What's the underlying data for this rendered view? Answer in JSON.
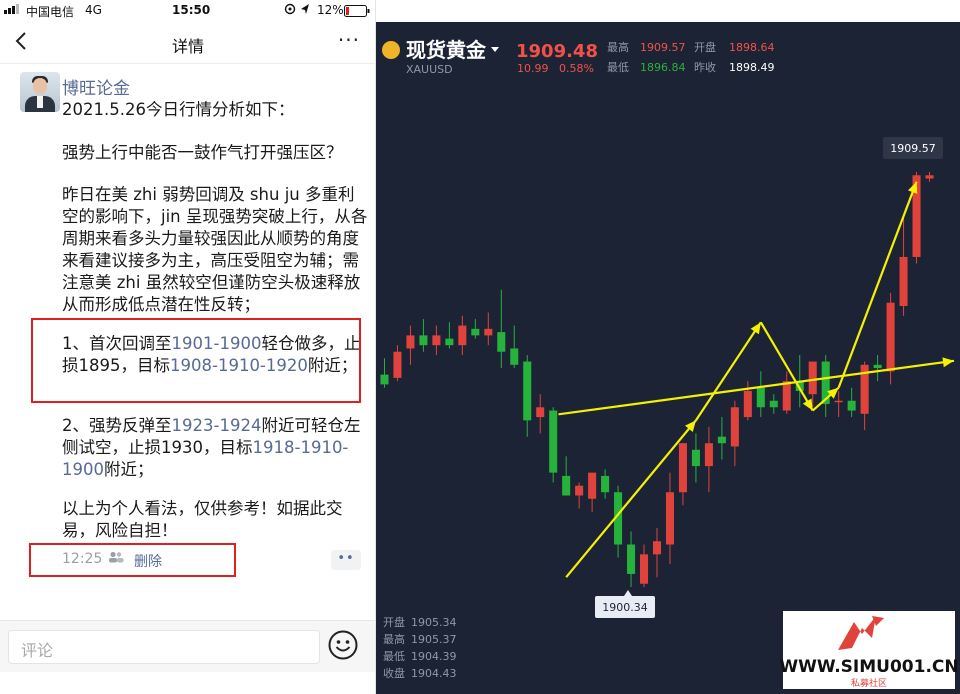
{
  "status_bar": {
    "carrier": "中国电信",
    "network": "4G",
    "time": "15:50",
    "battery_percent": "12%"
  },
  "nav": {
    "back_icon": "chevron-left-icon",
    "title": "详情",
    "more_icon": "more-dots-icon",
    "more_text": "···"
  },
  "post": {
    "author": "博旺论金",
    "date_line": "2021.5.26今日行情分析如下：",
    "question": "强势上行中能否一鼓作气打开强压区？",
    "body": "昨日在美  zhi  弱势回调及  shu  ju  多重利空的影响下，jin  呈现强势突破上行，从各周期来看多头力量较强因此从顺势的角度来看建议接多为主，高压受阻空为辅；需注意美  zhi  虽然较空但谨防空头极速释放从而形成低点潜在性反转；",
    "plan1": {
      "prefix": "1、首次回调至",
      "zone": "1901-1900",
      "mid": "轻仓做多，止损1895，目标",
      "targets": "1908-1910-1920",
      "suffix": "附近；"
    },
    "plan2": {
      "prefix": "2、强势反弹至",
      "zone": "1923-1924",
      "mid": "附近可轻仓左侧试空，止损1930，目标",
      "targets": "1918-1910-1900",
      "suffix": "附近；"
    },
    "disclaimer": "以上为个人看法，仅供参考！如据此交易，风险自担！",
    "time": "12:25",
    "delete_label": "删除",
    "more_label": "••"
  },
  "comment": {
    "placeholder": "评论",
    "emoji_icon": "smiley-icon"
  },
  "chart": {
    "name": "现货黄金",
    "symbol": "XAUUSD",
    "price": "1909.48",
    "change": "10.99",
    "change_pct": "0.58%",
    "stats": {
      "high_label": "最高",
      "high": "1909.57",
      "open_label": "开盘",
      "open": "1898.64",
      "low_label": "最低",
      "low": "1896.84",
      "prev_label": "昨收",
      "prev": "1898.49"
    },
    "bottom_info": [
      {
        "label": "开盘",
        "value": "1905.34"
      },
      {
        "label": "最高",
        "value": "1905.37"
      },
      {
        "label": "最低",
        "value": "1904.39"
      },
      {
        "label": "收盘",
        "value": "1904.43"
      }
    ],
    "tag_high": "1909.57",
    "tag_low": "1900.34",
    "colors": {
      "background": "#1c2334",
      "up": "#e0433b",
      "down": "#27b23c",
      "annotation": "#f5f200",
      "text_muted": "#8f97a8",
      "price_red": "#f0524a"
    }
  },
  "watermark": {
    "text": "WWW.SIMU001.CN",
    "subtext": "私募社区"
  },
  "chart_data": {
    "type": "candlestick",
    "title": "现货黄金",
    "candles": [
      {
        "o": 1903.4,
        "h": 1903.9,
        "l": 1903.0,
        "c": 1903.1
      },
      {
        "o": 1903.3,
        "h": 1904.3,
        "l": 1903.2,
        "c": 1904.1
      },
      {
        "o": 1904.2,
        "h": 1904.9,
        "l": 1903.7,
        "c": 1904.6
      },
      {
        "o": 1904.6,
        "h": 1905.1,
        "l": 1904.1,
        "c": 1904.3
      },
      {
        "o": 1904.3,
        "h": 1904.9,
        "l": 1904.0,
        "c": 1904.6
      },
      {
        "o": 1904.5,
        "h": 1905.0,
        "l": 1904.2,
        "c": 1904.3
      },
      {
        "o": 1904.3,
        "h": 1905.2,
        "l": 1904.0,
        "c": 1904.9
      },
      {
        "o": 1904.8,
        "h": 1905.1,
        "l": 1904.5,
        "c": 1904.6
      },
      {
        "o": 1904.6,
        "h": 1905.3,
        "l": 1904.3,
        "c": 1904.8
      },
      {
        "o": 1904.7,
        "h": 1906.0,
        "l": 1903.6,
        "c": 1904.1
      },
      {
        "o": 1904.2,
        "h": 1904.9,
        "l": 1903.6,
        "c": 1903.7
      },
      {
        "o": 1903.8,
        "h": 1904.0,
        "l": 1901.5,
        "c": 1902.0
      },
      {
        "o": 1902.1,
        "h": 1902.8,
        "l": 1901.6,
        "c": 1902.4
      },
      {
        "o": 1902.3,
        "h": 1902.4,
        "l": 1900.1,
        "c": 1900.4
      },
      {
        "o": 1900.3,
        "h": 1900.9,
        "l": 1899.9,
        "c": 1899.7
      },
      {
        "o": 1899.7,
        "h": 1900.1,
        "l": 1899.3,
        "c": 1900.0
      },
      {
        "o": 1899.6,
        "h": 1900.4,
        "l": 1899.2,
        "c": 1900.4
      },
      {
        "o": 1900.3,
        "h": 1900.5,
        "l": 1899.6,
        "c": 1899.8
      },
      {
        "o": 1899.8,
        "h": 1900.0,
        "l": 1897.8,
        "c": 1898.2
      },
      {
        "o": 1898.2,
        "h": 1898.6,
        "l": 1896.9,
        "c": 1897.3
      },
      {
        "o": 1897.0,
        "h": 1898.2,
        "l": 1896.9,
        "c": 1897.9
      },
      {
        "o": 1897.9,
        "h": 1898.7,
        "l": 1897.2,
        "c": 1898.3
      },
      {
        "o": 1898.2,
        "h": 1900.4,
        "l": 1897.6,
        "c": 1899.8
      },
      {
        "o": 1899.8,
        "h": 1901.3,
        "l": 1899.4,
        "c": 1901.3
      },
      {
        "o": 1901.1,
        "h": 1901.6,
        "l": 1900.1,
        "c": 1900.6
      },
      {
        "o": 1900.6,
        "h": 1901.8,
        "l": 1899.8,
        "c": 1901.3
      },
      {
        "o": 1901.5,
        "h": 1902.1,
        "l": 1900.8,
        "c": 1901.3
      },
      {
        "o": 1901.2,
        "h": 1902.6,
        "l": 1900.6,
        "c": 1902.4
      },
      {
        "o": 1902.1,
        "h": 1903.2,
        "l": 1902.0,
        "c": 1902.9
      },
      {
        "o": 1903.0,
        "h": 1903.5,
        "l": 1902.1,
        "c": 1902.4
      },
      {
        "o": 1902.6,
        "h": 1902.8,
        "l": 1902.2,
        "c": 1902.4
      },
      {
        "o": 1902.3,
        "h": 1903.5,
        "l": 1902.2,
        "c": 1903.2
      },
      {
        "o": 1903.2,
        "h": 1904.0,
        "l": 1902.4,
        "c": 1902.9
      },
      {
        "o": 1902.8,
        "h": 1903.7,
        "l": 1902.4,
        "c": 1903.8
      },
      {
        "o": 1903.8,
        "h": 1904.0,
        "l": 1902.1,
        "c": 1902.5
      },
      {
        "o": 1902.6,
        "h": 1902.9,
        "l": 1902.1,
        "c": 1902.6
      },
      {
        "o": 1902.6,
        "h": 1903.0,
        "l": 1902.1,
        "c": 1902.3
      },
      {
        "o": 1902.2,
        "h": 1903.8,
        "l": 1901.7,
        "c": 1903.7
      },
      {
        "o": 1903.7,
        "h": 1904.0,
        "l": 1903.2,
        "c": 1903.6
      },
      {
        "o": 1903.5,
        "h": 1905.9,
        "l": 1903.1,
        "c": 1905.6
      },
      {
        "o": 1905.5,
        "h": 1908.2,
        "l": 1905.2,
        "c": 1907.0
      },
      {
        "o": 1907.0,
        "h": 1909.6,
        "l": 1906.8,
        "c": 1909.5
      },
      {
        "o": 1909.4,
        "h": 1909.6,
        "l": 1909.3,
        "c": 1909.5
      }
    ],
    "annotation_points": {
      "support_line": [
        [
          0,
          1902.0
        ],
        [
          42,
          1903.7
        ]
      ],
      "zigzag": [
        [
          14,
          1897.2
        ],
        [
          24,
          1902.0
        ],
        [
          29,
          1905.0
        ],
        [
          33,
          1902.3
        ],
        [
          35,
          1903.0
        ],
        [
          41,
          1909.3
        ]
      ]
    },
    "labels": {
      "high": "1909.57",
      "low": "1900.34"
    }
  }
}
